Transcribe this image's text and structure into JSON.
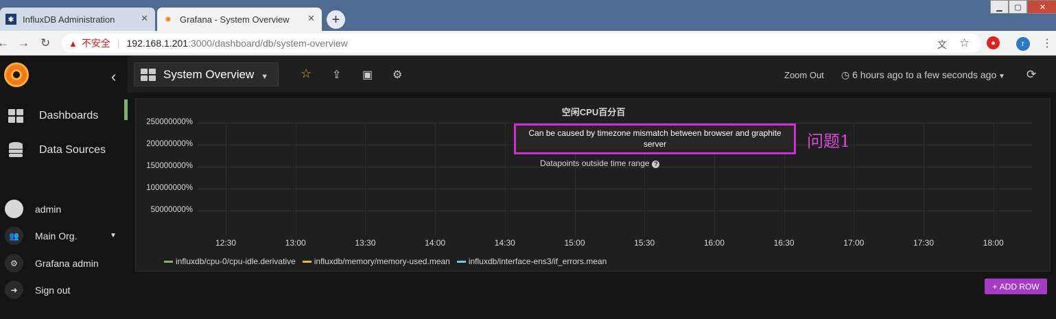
{
  "browser": {
    "tabs": [
      {
        "title": "InfluxDB Administration",
        "active": false
      },
      {
        "title": "Grafana - System Overview",
        "active": true
      }
    ],
    "url_warning": "不安全",
    "url_host": "192.168.1.201",
    "url_path": ":3000/dashboard/db/system-overview",
    "profile_initial": "r"
  },
  "sidebar": {
    "items": [
      {
        "label": "Dashboards",
        "icon": "dashboards-icon"
      },
      {
        "label": "Data Sources",
        "icon": "database-icon"
      }
    ],
    "user": [
      {
        "label": "admin",
        "icon": "avatar"
      },
      {
        "label": "Main Org.",
        "icon": "users-icon"
      },
      {
        "label": "Grafana admin",
        "icon": "gear-icon"
      },
      {
        "label": "Sign out",
        "icon": "sign-out-icon"
      }
    ]
  },
  "topnav": {
    "dashboard_title": "System Overview",
    "zoom_out": "Zoom Out",
    "time_range": "6 hours ago to a few seconds ago"
  },
  "panel": {
    "title": "空闲CPU百分百",
    "alert": "Can be caused by timezone mismatch between browser and graphite server",
    "outside_range": "Datapoints outside time range",
    "annotation": "问题1"
  },
  "chart_data": {
    "type": "line",
    "title": "空闲CPU百分百",
    "y_ticks": [
      "250000000%",
      "200000000%",
      "150000000%",
      "100000000%",
      "50000000%"
    ],
    "x_ticks": [
      "12:30",
      "13:00",
      "13:30",
      "14:00",
      "14:30",
      "15:00",
      "15:30",
      "16:00",
      "16:30",
      "17:00",
      "17:30",
      "18:00"
    ],
    "series": [
      {
        "name": "influxdb/cpu-0/cpu-idle.derivative",
        "color": "#7eb26d",
        "values": []
      },
      {
        "name": "influxdb/memory/memory-used.mean",
        "color": "#eab839",
        "values": []
      },
      {
        "name": "influxdb/interface-ens3/if_errors.mean",
        "color": "#6ed0e0",
        "values": []
      }
    ]
  },
  "actions": {
    "add_row": "ADD ROW"
  }
}
